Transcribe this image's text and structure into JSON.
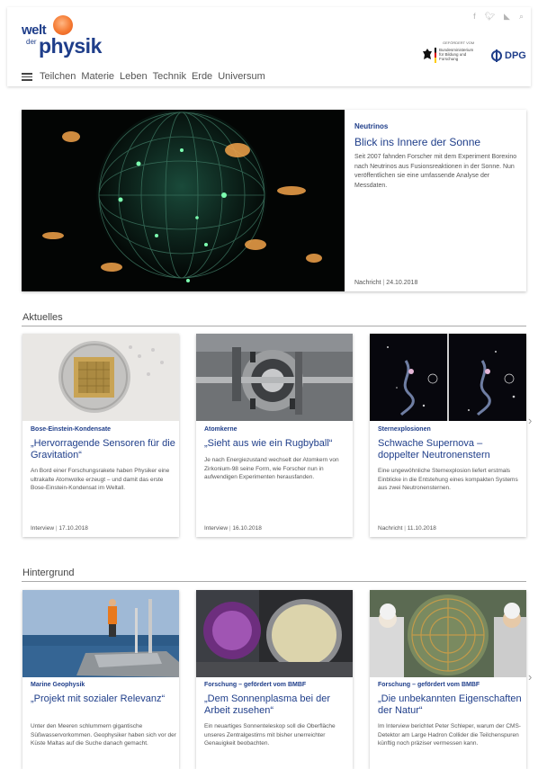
{
  "header": {
    "logo": {
      "welt": "welt",
      "der": "der",
      "physik": "physik"
    },
    "sponsor": {
      "caption": "GEFÖRDERT VOM",
      "ministry": "Bundesministerium für Bildung und Forschung",
      "dpg": "DPG"
    },
    "social_icons": [
      "facebook-icon",
      "twitter-icon",
      "rss-icon",
      "search-icon"
    ],
    "nav": [
      "Teilchen",
      "Materie",
      "Leben",
      "Technik",
      "Erde",
      "Universum"
    ]
  },
  "hero": {
    "category": "Neutrinos",
    "title": "Blick ins Innere der Sonne",
    "text": "Seit 2007 fahnden Forscher mit dem Experiment Borexino nach Neutrinos aus Fusionsreaktionen in der Sonne. Nun veröffentlichen sie eine umfassende Analyse der Messdaten.",
    "type": "Nachricht",
    "date": "24.10.2018"
  },
  "aktuelles": {
    "heading": "Aktuelles",
    "cards": [
      {
        "category": "Bose-Einstein-Kondensate",
        "title": "„Hervorragende Sensoren für die Gravitation“",
        "text": "An Bord einer Forschungsrakete haben Physiker eine ultrakalte Atomwolke erzeugt – und damit das erste Bose-Einstein-Kondensat im Weltall.",
        "type": "Interview",
        "date": "17.10.2018"
      },
      {
        "category": "Atomkerne",
        "title": "„Sieht aus wie ein Rugbyball“",
        "text": "Je nach Energiezustand wechselt der Atomkern von Zirkonium-98 seine Form, wie Forscher nun in aufwendigen Experimenten herausfanden.",
        "type": "Interview",
        "date": "16.10.2018"
      },
      {
        "category": "Sternexplosionen",
        "title": "Schwache Supernova – doppelter Neutronenstern",
        "text": "Eine ungewöhnliche Sternexplosion liefert erstmals Einblicke in die Entstehung eines kompakten Systems aus zwei Neutronensternen.",
        "type": "Nachricht",
        "date": "11.10.2018"
      }
    ]
  },
  "hintergrund": {
    "heading": "Hintergrund",
    "cards": [
      {
        "category": "Marine Geophysik",
        "title": "„Projekt mit sozialer Relevanz“",
        "text": "Unter den Meeren schlummern gigantische Süßwasservorkommen. Geophysiker haben sich vor der Küste Maltas auf die Suche danach gemacht."
      },
      {
        "category": "Forschung – gefördert vom BMBF",
        "title": "„Dem Sonnenplasma bei der Arbeit zusehen“",
        "text": "Ein neuartiges Sonnenteleskop soll die Oberfläche unseres Zentralgestirns mit bisher unerreichter Genauigkeit beobachten."
      },
      {
        "category": "Forschung – gefördert vom BMBF",
        "title": "„Die unbekannten Eigenschaften der Natur“",
        "text": "Im Interview berichtet Peter Schleper, warum der CMS-Detektor am Large Hadron Collider die Teilchenspuren künftig noch präziser vermessen kann."
      }
    ]
  },
  "colors": {
    "brand_blue": "#1f3e8a",
    "logo_orange": "#f57a32"
  }
}
